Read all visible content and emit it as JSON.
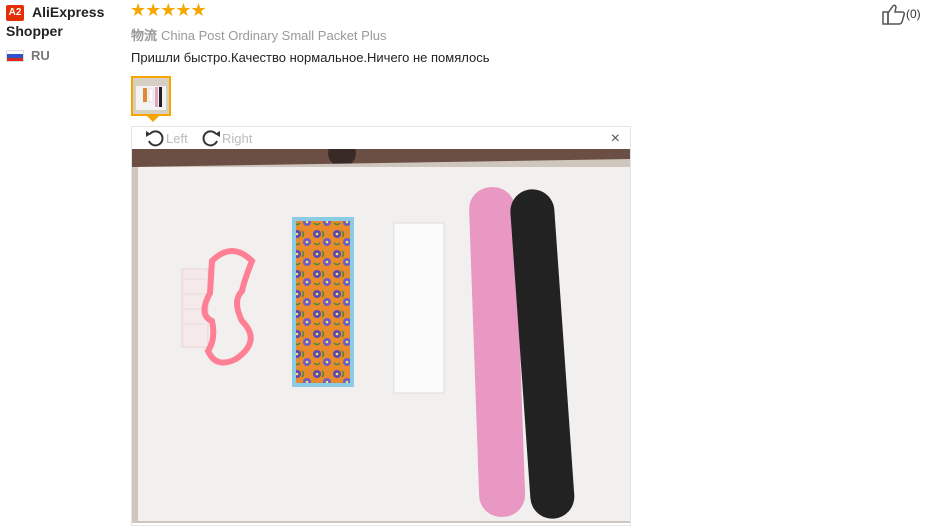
{
  "reviewer": {
    "badge": "A2",
    "name_line1": "AliExpress",
    "name_line2": "Shopper",
    "country": "RU"
  },
  "rating": {
    "stars": 5,
    "max": 5,
    "star_glyphs": "★★★★★"
  },
  "shipping": {
    "prefix": "物流",
    "method": "China Post Ordinary Small Packet Plus"
  },
  "review_text": "Пришли быстро.Качество нормальное.Ничего не помялось",
  "viewer": {
    "rotate_left_label": "Left",
    "rotate_right_label": "Right",
    "close_glyph": "×"
  },
  "helpful": {
    "count": "(0)"
  },
  "colors": {
    "star": "#f7a600",
    "badge": "#e62e04",
    "thumb_border": "#f7a600"
  }
}
